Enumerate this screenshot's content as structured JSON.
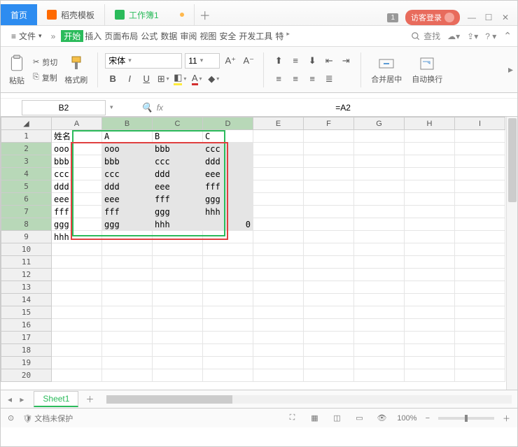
{
  "title": {
    "home": "首页",
    "templates": "稻壳模板",
    "workbook": "工作簿1",
    "login": "访客登录",
    "badge": "1"
  },
  "menu": {
    "file": "文件",
    "more": "»",
    "tabs": [
      "开始",
      "插入",
      "页面布局",
      "公式",
      "数据",
      "审阅",
      "视图",
      "安全",
      "开发工具",
      "特"
    ],
    "search": "查找"
  },
  "ribbon": {
    "paste": "粘贴",
    "cut": "剪切",
    "copy": "复制",
    "formatPainter": "格式刷",
    "font": "宋体",
    "size": "11",
    "merge": "合并居中",
    "wrap": "自动换行"
  },
  "nameBox": "B2",
  "formula": "=A2",
  "columns": [
    "A",
    "B",
    "C",
    "D",
    "E",
    "F",
    "G",
    "H",
    "I"
  ],
  "rows": [
    "1",
    "2",
    "3",
    "4",
    "5",
    "6",
    "7",
    "8",
    "9",
    "10",
    "11",
    "12",
    "13",
    "14",
    "15",
    "16",
    "17",
    "18",
    "19",
    "20"
  ],
  "cells": {
    "A1": "姓名",
    "B1": "A",
    "C1": "B",
    "D1": "C",
    "A2": "ooo",
    "B2": "ooo",
    "C2": "bbb",
    "D2": "ccc",
    "A3": "bbb",
    "B3": "bbb",
    "C3": "ccc",
    "D3": "ddd",
    "A4": "ccc",
    "B4": "ccc",
    "C4": "ddd",
    "D4": "eee",
    "A5": "ddd",
    "B5": "ddd",
    "C5": "eee",
    "D5": "fff",
    "A6": "eee",
    "B6": "eee",
    "C6": "fff",
    "D6": "ggg",
    "A7": "fff",
    "B7": "fff",
    "C7": "ggg",
    "D7": "hhh",
    "A8": "ggg",
    "B8": "ggg",
    "C8": "hhh",
    "D8": "0",
    "A9": "hhh"
  },
  "sheet": "Sheet1",
  "status": {
    "protect": "文档未保护",
    "zoom": "100%"
  }
}
